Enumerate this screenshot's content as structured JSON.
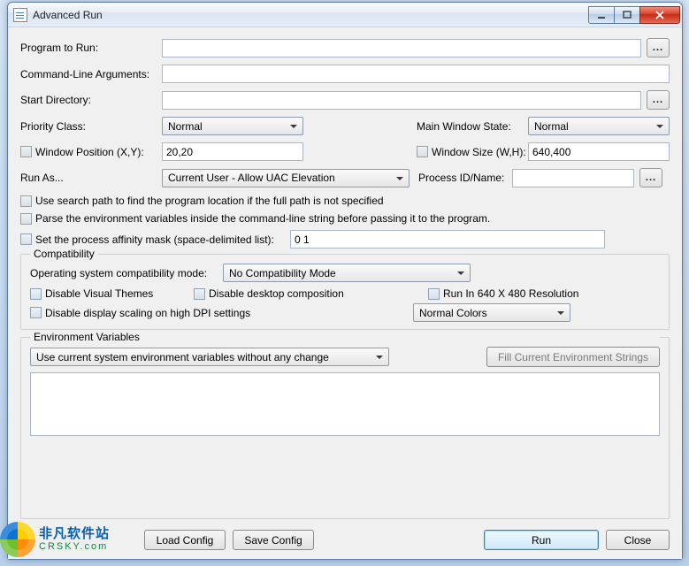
{
  "titlebar": {
    "title": "Advanced Run"
  },
  "labels": {
    "program": "Program to Run:",
    "args": "Command-Line Arguments:",
    "startdir": "Start Directory:",
    "priority": "Priority Class:",
    "mainwin": "Main Window State:",
    "winpos": "Window Position (X,Y):",
    "winsize": "Window Size (W,H):",
    "runas": "Run As...",
    "procid": "Process ID/Name:",
    "ellipsis": "..."
  },
  "values": {
    "program": "",
    "args": "",
    "startdir": "",
    "winpos": "20,20",
    "winsize": "640,400",
    "procid": "",
    "affinity": "0 1",
    "envtext": ""
  },
  "selects": {
    "priority": "Normal",
    "mainwin": "Normal",
    "runas": "Current User - Allow UAC Elevation",
    "compat": "No Compatibility Mode",
    "colors": "Normal Colors",
    "env": "Use current system environment variables without any change"
  },
  "checks": {
    "searchpath": "Use search path to find the program location if the full path is not specified",
    "parseenv": "Parse the environment variables inside the command-line string before passing it to the program.",
    "affinity": "Set the process affinity mask (space-delimited list):",
    "disableThemes": "Disable Visual Themes",
    "disableComp": "Disable desktop composition",
    "run640": "Run In 640 X 480 Resolution",
    "disableDpi": "Disable display scaling on high DPI settings"
  },
  "groups": {
    "compat": "Compatibility",
    "compatMode": "Operating system compatibility mode:",
    "env": "Environment Variables"
  },
  "buttons": {
    "fillEnv": "Fill Current Environment Strings",
    "loadCfg": "Load Config",
    "saveCfg": "Save Config",
    "run": "Run",
    "close": "Close"
  },
  "watermark": {
    "line1": "非凡软件站",
    "line2": "CRSKY.com"
  }
}
